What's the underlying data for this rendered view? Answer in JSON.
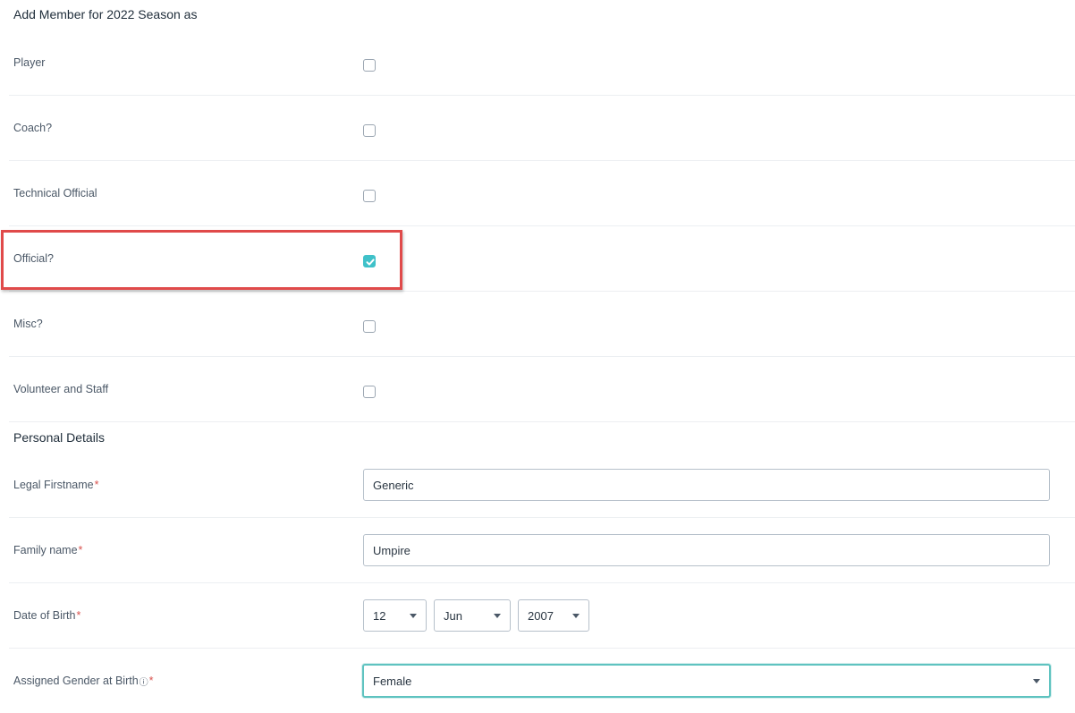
{
  "membership": {
    "title": "Add Member for 2022 Season as",
    "roles": [
      {
        "label": "Player",
        "checked": false
      },
      {
        "label": "Coach?",
        "checked": false
      },
      {
        "label": "Technical Official",
        "checked": false
      },
      {
        "label": "Official?",
        "checked": true
      },
      {
        "label": "Misc?",
        "checked": false
      },
      {
        "label": "Volunteer and Staff",
        "checked": false
      }
    ]
  },
  "personal": {
    "title": "Personal Details",
    "first_name_label": "Legal Firstname",
    "first_name_value": "Generic",
    "family_name_label": "Family name",
    "family_name_value": "Umpire",
    "dob_label": "Date of Birth",
    "dob_day": "12",
    "dob_month": "Jun",
    "dob_year": "2007",
    "gender_label": "Assigned Gender at Birth",
    "gender_info_icon": "ⓘ",
    "gender_value": "Female",
    "required_marker": "*"
  },
  "colors": {
    "accent": "#3fc1c9",
    "highlight": "#e04a4a",
    "required": "#d9534f"
  }
}
